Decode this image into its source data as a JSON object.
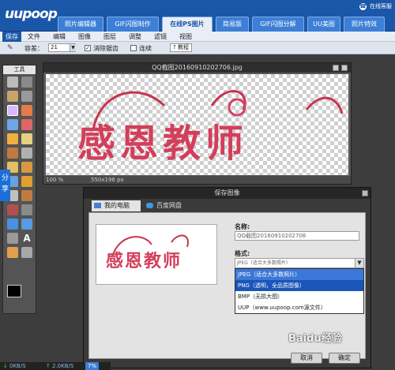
{
  "header": {
    "logo": "uupoop",
    "tabs": [
      "照片编辑器",
      "GIF闪图制作",
      "在线PS图片",
      "简易版",
      "GIF闪图分解",
      "UU美图",
      "照片特效"
    ],
    "active_tab": "在线PS图片",
    "online_label": "在线客服",
    "online_icon": "headset-icon"
  },
  "menu": [
    "保存",
    "文件",
    "编辑",
    "图像",
    "图层",
    "调整",
    "滤镜",
    "视图"
  ],
  "options": {
    "tolerance_label": "容差：",
    "tolerance_value": "21",
    "antialias_label": "消除锯齿",
    "antialias_checked": true,
    "contiguous_label": "连续",
    "contiguous_checked": false,
    "help_label": "教程"
  },
  "toolbox": {
    "title": "工具",
    "share_label": "分享"
  },
  "image_window": {
    "title": "QQ截图20160910202706.jpg",
    "zoom": "100 %",
    "size": "550x196 px",
    "art_text": "感恩教师"
  },
  "dialog": {
    "title": "保存图像",
    "tab_local": "我的电脑",
    "tab_cloud": "百度网盘",
    "name_label": "名称:",
    "name_value": "QQ截图20160910202706",
    "format_label": "格式:",
    "format_value": "JPEG（适合大多数照片）",
    "options": [
      "JPEG（适合大多数照片）",
      "PNG（透明，全品质图像）",
      "BMP（无损大图）",
      "UUP（www.uupoop.com源文件）"
    ],
    "selected_index": 1,
    "ok_label": "确定",
    "cancel_label": "取消"
  },
  "status": {
    "down": "0KB/S",
    "up": "2.0KB/S",
    "percent": "7%"
  },
  "watermark": "Baidu经验"
}
